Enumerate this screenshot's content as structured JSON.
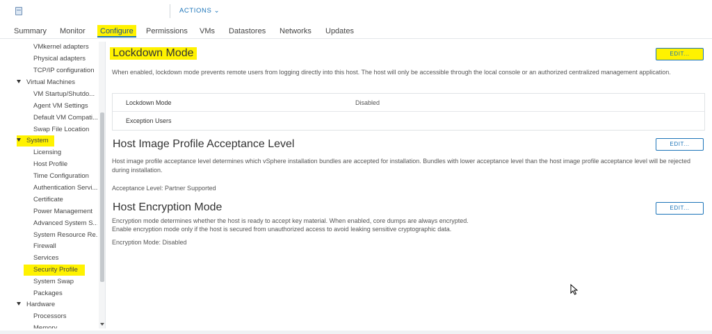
{
  "header": {
    "host_name": "                              ",
    "actions_label": "ACTIONS ⌄"
  },
  "tabs": [
    {
      "label": "Summary"
    },
    {
      "label": "Monitor"
    },
    {
      "label": "Configure"
    },
    {
      "label": "Permissions"
    },
    {
      "label": "VMs"
    },
    {
      "label": "Datastores"
    },
    {
      "label": "Networks"
    },
    {
      "label": "Updates"
    }
  ],
  "nav": {
    "items": [
      {
        "label": "VMkernel adapters"
      },
      {
        "label": "Physical adapters"
      },
      {
        "label": "TCP/IP configuration"
      },
      {
        "label": "Virtual Machines"
      },
      {
        "label": "VM Startup/Shutdo..."
      },
      {
        "label": "Agent VM Settings"
      },
      {
        "label": "Default VM Compati..."
      },
      {
        "label": "Swap File Location"
      },
      {
        "label": "System"
      },
      {
        "label": "Licensing"
      },
      {
        "label": "Host Profile"
      },
      {
        "label": "Time Configuration"
      },
      {
        "label": "Authentication Servi..."
      },
      {
        "label": "Certificate"
      },
      {
        "label": "Power Management"
      },
      {
        "label": "Advanced System S..."
      },
      {
        "label": "System Resource Re..."
      },
      {
        "label": "Firewall"
      },
      {
        "label": "Services"
      },
      {
        "label": "Security Profile"
      },
      {
        "label": "System Swap"
      },
      {
        "label": "Packages"
      },
      {
        "label": "Hardware"
      },
      {
        "label": "Processors"
      },
      {
        "label": "Memory"
      }
    ]
  },
  "lockdown": {
    "title": "Lockdown Mode",
    "edit_label": "EDIT...",
    "description": "When enabled, lockdown mode prevents remote users from logging directly into this host. The host will only be accessible through the local console or an authorized centralized management application.",
    "rows": [
      {
        "label": "Lockdown Mode",
        "value": "Disabled"
      },
      {
        "label": "Exception Users",
        "value": ""
      }
    ]
  },
  "acceptance": {
    "title": "Host Image Profile Acceptance Level",
    "edit_label": "EDIT...",
    "description": "Host image profile acceptance level determines which vSphere installation bundles are accepted for installation. Bundles with lower acceptance level than the host image profile acceptance level will be rejected during installation.",
    "field": "Acceptance Level: Partner Supported"
  },
  "encryption": {
    "title": "Host Encryption Mode",
    "edit_label": "EDIT...",
    "description_1": "Encryption mode determines whether the host is ready to accept key material. When enabled, core dumps are always encrypted.",
    "description_2": "Enable encryption mode only if the host is secured from unauthorized access to avoid leaking sensitive cryptographic data.",
    "field": "Encryption Mode: Disabled"
  },
  "colors": {
    "highlight": "#fff200",
    "accent": "#1a73b8"
  }
}
